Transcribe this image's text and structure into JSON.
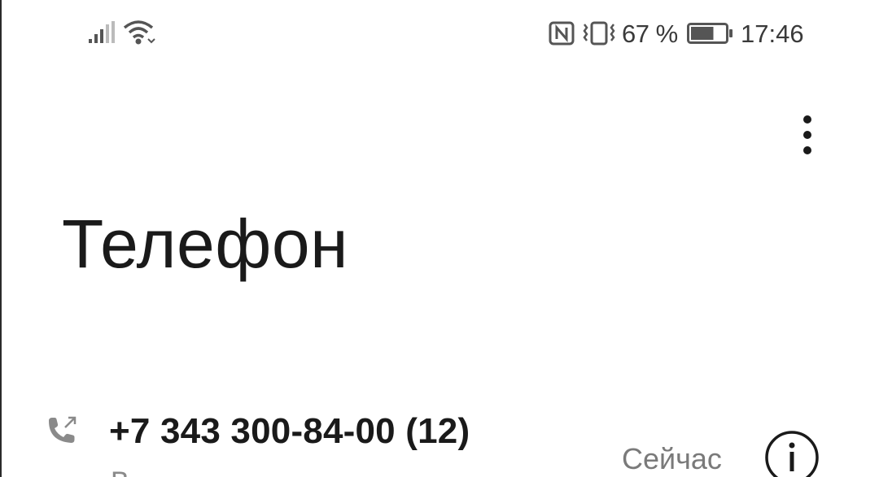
{
  "status_bar": {
    "battery_percent": "67 %",
    "battery_level": 0.67,
    "time": "17:46",
    "icons": [
      "signal-icon",
      "wifi-icon",
      "nfc-icon",
      "vibrate-icon",
      "battery-icon"
    ]
  },
  "toolbar": {
    "more_icon": "more-vert-icon"
  },
  "page": {
    "title": "Телефон"
  },
  "call_log": [
    {
      "number": "+7 343 300-84-00 (12)",
      "subtitle": "В...",
      "time": "Сейчас",
      "direction_icon": "outgoing-call-icon",
      "info_icon": "info-icon"
    }
  ]
}
